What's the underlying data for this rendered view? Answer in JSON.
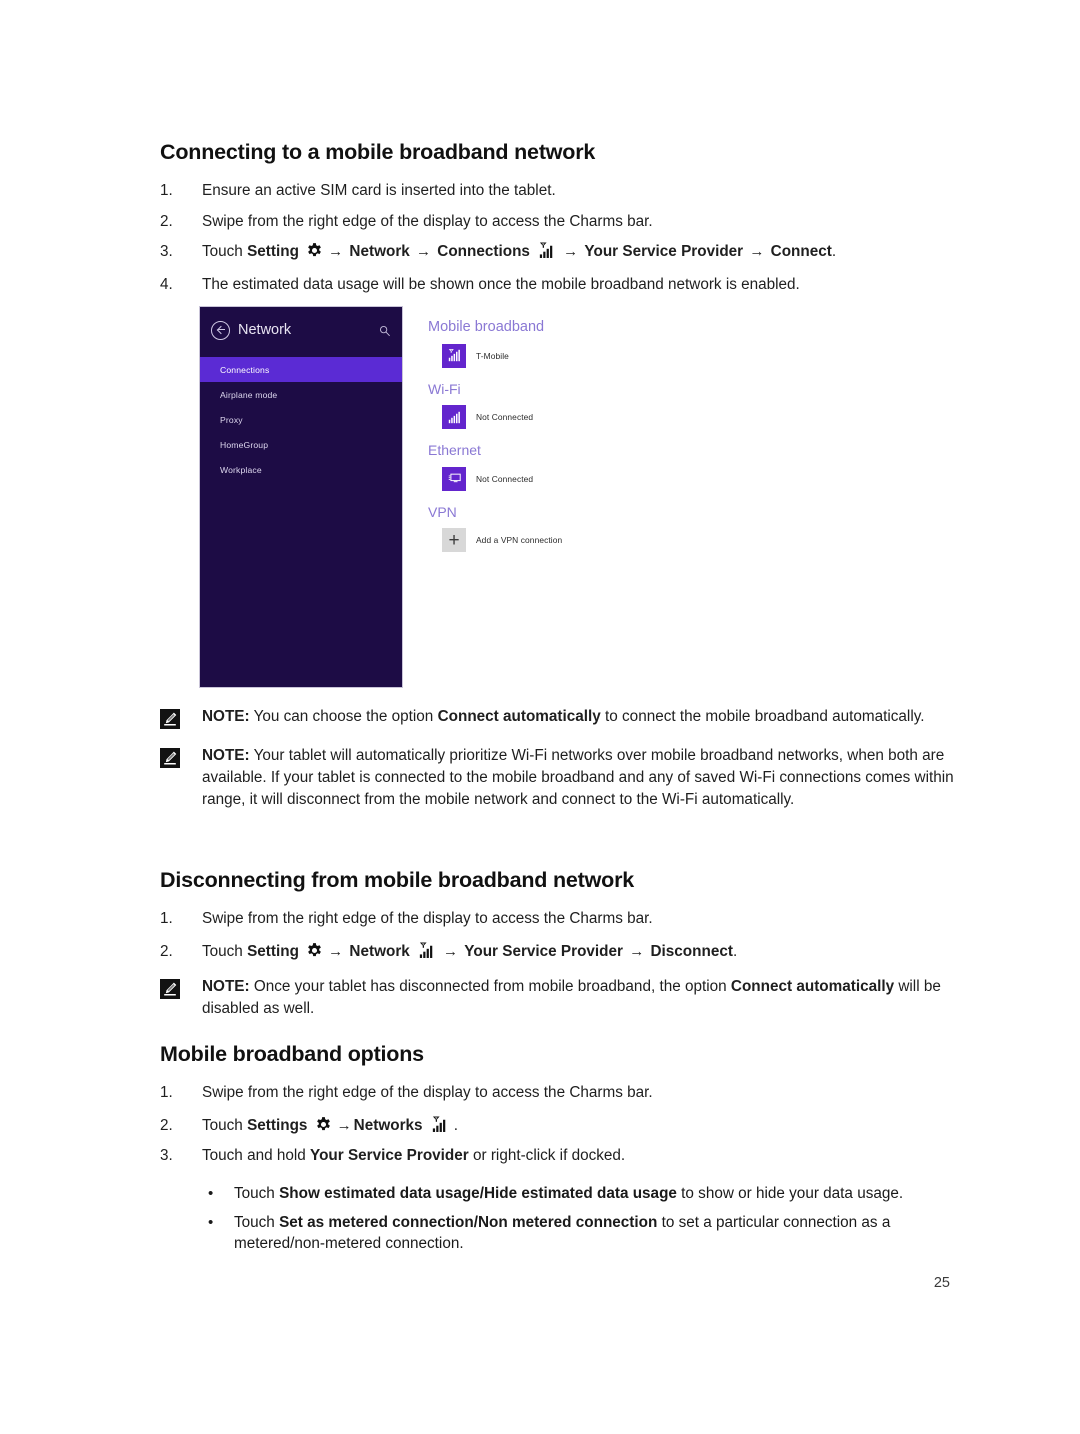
{
  "page": {
    "number": "25"
  },
  "sections": [
    {
      "heading": "Connecting to a mobile broadband network",
      "steps": [
        {
          "num": "1.",
          "text": "Ensure an active SIM card is inserted into the tablet."
        },
        {
          "num": "2.",
          "text": "Swipe from the right edge of the display to access the Charms bar."
        },
        {
          "num": "3.",
          "text": "Touch Setting [gear-icon] → Network → Connections [signal-icon] → Your Service Provider → Connect."
        },
        {
          "num": "4.",
          "text": "The estimated data usage will be shown once the mobile broadband network is enabled."
        }
      ],
      "step3_parts": {
        "lead": "Touch ",
        "b1": "Setting",
        "arrow1": "→",
        "b2": "Network",
        "arrow2": "→",
        "b3": "Connections",
        "arrow3": "→",
        "b4": "Your Service Provider",
        "arrow4": "→",
        "b5": "Connect",
        "period": "."
      }
    },
    {
      "heading": "Disconnecting from mobile broadband network",
      "steps": [
        {
          "num": "1.",
          "text": "Swipe from the right edge of the display to access the Charms bar."
        }
      ],
      "step2_parts": {
        "num": "2.",
        "lead": "Touch ",
        "b1": "Setting",
        "arrow1": "→",
        "b2": "Network",
        "arrow2": "→",
        "b3": "Your Service Provider",
        "arrow3": "→",
        "b4": "Disconnect",
        "period": "."
      }
    },
    {
      "heading": "Mobile broadband options",
      "steps": [
        {
          "num": "1.",
          "text": "Swipe from the right edge of the display to access the Charms bar."
        }
      ],
      "step2_parts": {
        "num": "2.",
        "lead": "Touch ",
        "b1": "Settings",
        "arrow1": "→",
        "b2": "Networks",
        "period": "."
      },
      "step3": {
        "num": "3.",
        "lead": "Touch and hold ",
        "bold": "Your Service Provider",
        "tail": " or right-click if docked."
      },
      "bullets": [
        {
          "dot": "•",
          "lead": "Touch ",
          "bold": "Show estimated data usage/Hide estimated data usage",
          "tail": " to show or hide your data usage."
        },
        {
          "dot": "•",
          "lead": "Touch ",
          "bold": "Set as metered connection/Non metered connection",
          "tail": " to set a particular connection as a metered/non-metered connection."
        }
      ]
    }
  ],
  "notes": [
    {
      "label": "NOTE:",
      "lead": " You can choose the option ",
      "bold": "Connect automatically",
      "tail": " to connect the mobile broadband automatically."
    },
    {
      "label": "NOTE:",
      "lead": " Your tablet will automatically prioritize Wi-Fi networks over mobile broadband networks, when both are available. If your tablet is connected to the mobile broadband and any of saved Wi-Fi connections comes within range, it will disconnect from the mobile network and connect to the Wi-Fi automatically.",
      "bold": "",
      "tail": ""
    },
    {
      "label": "NOTE:",
      "lead": " Once your tablet has disconnected from mobile broadband, the option ",
      "bold": "Connect automatically",
      "tail": " will be disabled as well."
    }
  ],
  "screenshot": {
    "title": "Network",
    "back_icon": "back-arrow-icon",
    "search_icon": "search-icon",
    "menu": [
      {
        "label": "Connections",
        "selected": true
      },
      {
        "label": "Airplane mode",
        "selected": false
      },
      {
        "label": "Proxy",
        "selected": false
      },
      {
        "label": "HomeGroup",
        "selected": false
      },
      {
        "label": "Workplace",
        "selected": false
      }
    ],
    "groups": [
      {
        "heading": "Mobile broadband",
        "items": [
          {
            "label": "T-Mobile",
            "icon": "mobile-signal-icon"
          }
        ]
      },
      {
        "heading": "Wi-Fi",
        "items": [
          {
            "label": "Not Connected",
            "icon": "wifi-signal-icon"
          }
        ]
      },
      {
        "heading": "Ethernet",
        "items": [
          {
            "label": "Not Connected",
            "icon": "ethernet-monitor-icon"
          }
        ]
      },
      {
        "heading": "VPN",
        "items": [
          {
            "label": "Add a VPN connection",
            "icon": "plus-icon"
          }
        ]
      }
    ],
    "colors": {
      "panel_bg": "#1d0c45",
      "selected_bg": "#5b2bd4",
      "tile_purple": "#6325cd",
      "tile_gray": "#d8d8d8",
      "heading_purple": "#8a78d4"
    }
  }
}
